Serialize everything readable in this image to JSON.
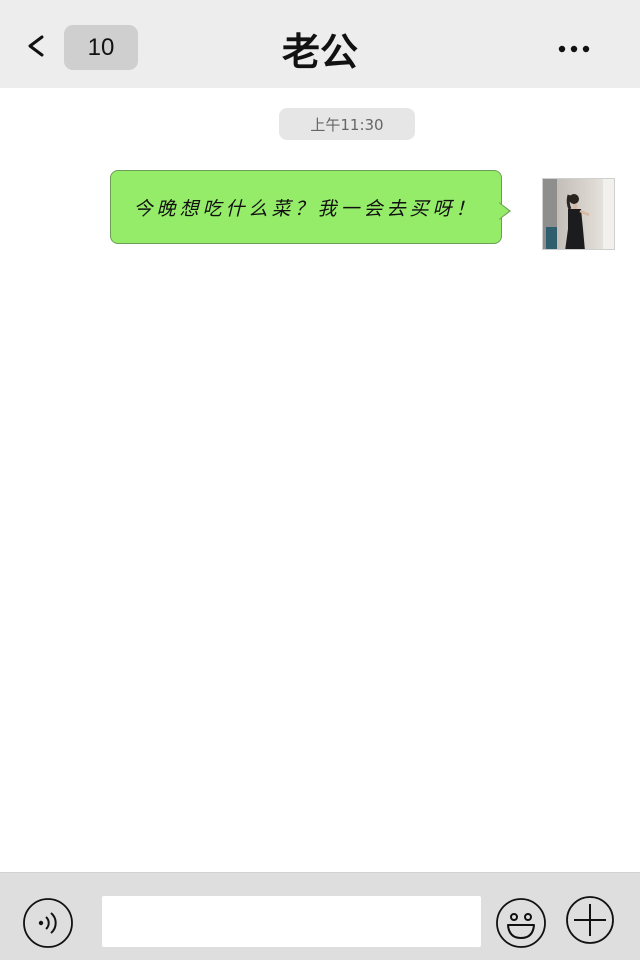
{
  "header": {
    "back_icon": "chevron-left-icon",
    "unread_count": "10",
    "title": "老公",
    "more_icon": "more-dots-icon",
    "background": "#ededed"
  },
  "messages": [
    {
      "timestamp": "上午11:30",
      "sender": "self",
      "text": "今晚想吃什么菜？我一会去买呀！",
      "bubble_color": "#95ec69",
      "avatar": "user-avatar-photo"
    }
  ],
  "input_bar": {
    "voice_icon": "voice-icon",
    "text_value": "",
    "emoji_icon": "emoji-icon",
    "plus_icon": "plus-icon"
  }
}
